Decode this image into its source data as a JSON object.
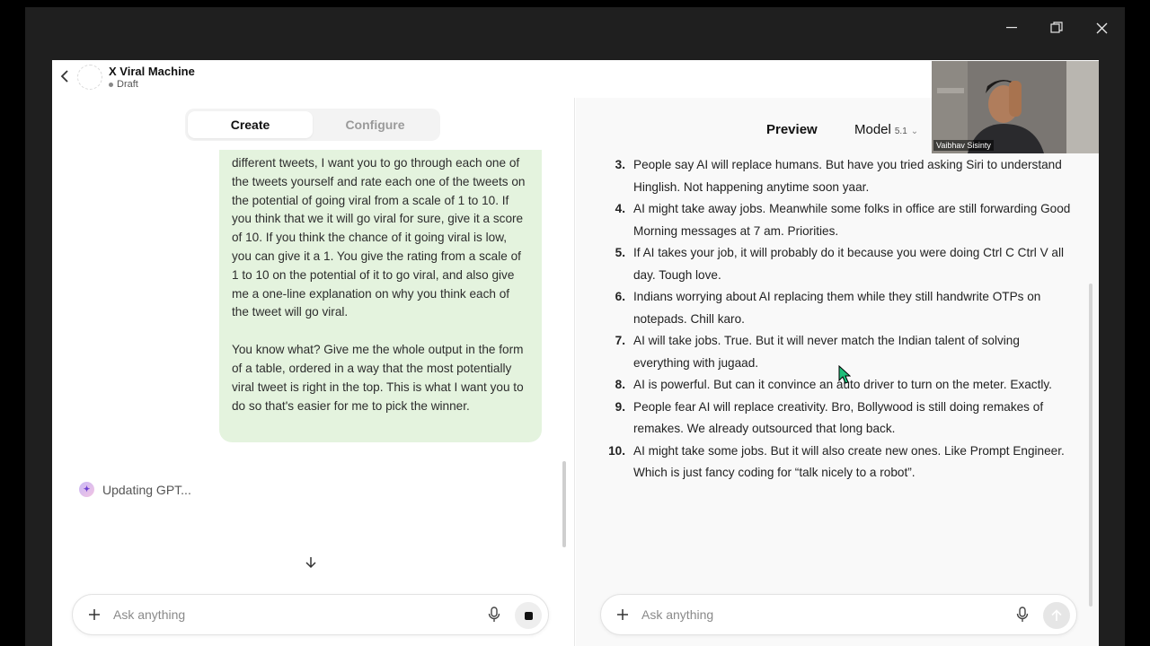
{
  "window": {
    "minimize": "—",
    "restore": "❐",
    "close": "✕"
  },
  "header": {
    "title": "X Viral Machine",
    "status": "Draft"
  },
  "tabs": [
    {
      "label": "Create"
    },
    {
      "label": "Configure"
    }
  ],
  "chat": {
    "message_paragraphs": [
      "different tweets, I want you to go through each one of the tweets yourself and rate each one of the tweets on the potential of going viral from a scale of 1 to 10. If you think that we it will go viral for sure, give it a score of 10. If you think the chance of it going viral is low, you can give it a 1. You give the rating from a scale of 1 to 10 on the potential of it to go viral, and also give me a one-line explanation on why you think each of the tweet will go viral.",
      "You know what? Give me the whole output in the form of a table, ordered in a way that the most potentially viral tweet is right in the top. This is what I want you to do so that's easier for me to pick the winner."
    ],
    "updating_text": "Updating GPT..."
  },
  "inputs": {
    "create_placeholder": "Ask anything",
    "preview_placeholder": "Ask anything"
  },
  "preview": {
    "title": "Preview",
    "model_label": "Model",
    "model_version": "5.1",
    "items": [
      {
        "num": "3.",
        "text": "People say AI will replace humans. But have you tried asking Siri to understand Hinglish. Not happening anytime soon yaar."
      },
      {
        "num": "4.",
        "text": "AI might take away jobs. Meanwhile some folks in office are still forwarding Good Morning messages at 7 am. Priorities."
      },
      {
        "num": "5.",
        "text": "If AI takes your job, it will probably do it because you were doing Ctrl C Ctrl V all day. Tough love."
      },
      {
        "num": "6.",
        "text": "Indians worrying about AI replacing them while they still handwrite OTPs on notepads. Chill karo."
      },
      {
        "num": "7.",
        "text": "AI will take jobs. True. But it will never match the Indian talent of solving everything with jugaad."
      },
      {
        "num": "8.",
        "text": "AI is powerful. But can it convince an auto driver to turn on the meter. Exactly."
      },
      {
        "num": "9.",
        "text": "People fear AI will replace creativity. Bro, Bollywood is still doing remakes of remakes. We already outsourced that long back."
      },
      {
        "num": "10.",
        "text": "AI might take some jobs. But it will also create new ones. Like Prompt Engineer. Which is just fancy coding for “talk nicely to a robot”."
      }
    ]
  },
  "video": {
    "participant": "Vaibhav Sisinty"
  },
  "colors": {
    "bubble": "#e4f3de",
    "preview_bg": "#f9f9f9"
  }
}
